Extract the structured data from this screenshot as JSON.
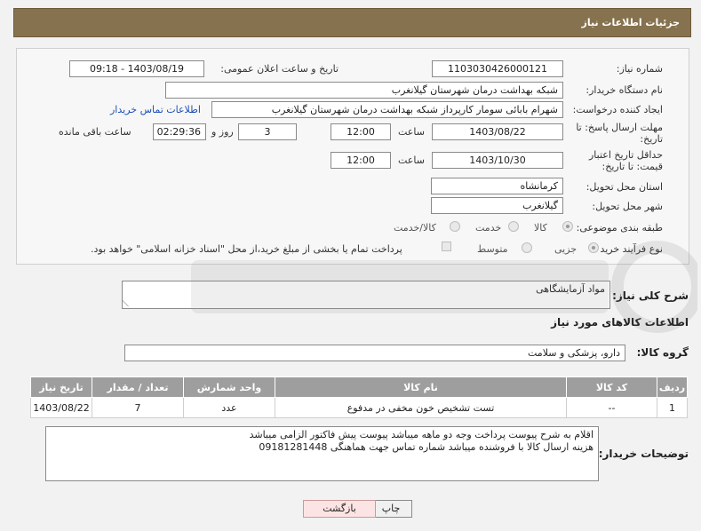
{
  "header": {
    "title": "جزئیات اطلاعات نیاز"
  },
  "form": {
    "need_number_label": "شماره نیاز:",
    "need_number": "1103030426000121",
    "announce_label": "تاریخ و ساعت اعلان عمومی:",
    "announce_value": "1403/08/19 - 09:18",
    "buyer_org_label": "نام دستگاه خریدار:",
    "buyer_org": "شبکه بهداشت درمان شهرستان گیلانغرب",
    "creator_label": "ایجاد کننده درخواست:",
    "creator": "شهرام بابائی سومار کارپرداز شبکه بهداشت درمان شهرستان گیلانغرب",
    "contact_link": "اطلاعات تماس خریدار",
    "reply_deadline_label": "مهلت ارسال پاسخ: تا تاریخ:",
    "reply_date": "1403/08/22",
    "time_label": "ساعت",
    "reply_time": "12:00",
    "days_value": "3",
    "days_label": "روز و",
    "remaining_time": "02:29:36",
    "remaining_label": "ساعت باقی مانده",
    "price_validity_label": "حداقل تاریخ اعتبار قیمت: تا تاریخ:",
    "price_date": "1403/10/30",
    "price_time": "12:00",
    "province_label": "استان محل تحویل:",
    "province": "کرمانشاه",
    "city_label": "شهر محل تحویل:",
    "city": "گیلانغرب",
    "category_label": "طبقه بندی موضوعی:",
    "category_options": [
      "کالا",
      "خدمت",
      "کالا/خدمت"
    ],
    "purchase_type_label": "نوع فرآیند خرید :",
    "purchase_options": [
      "جزیی",
      "متوسط"
    ],
    "treasury_note": "پرداخت تمام یا بخشی از مبلغ خرید،از محل \"اسناد خزانه اسلامی\" خواهد بود."
  },
  "description": {
    "label": "شرح کلی نیاز:",
    "value": "مواد آزمایشگاهی"
  },
  "goods_section": {
    "title": "اطلاعات کالاهای مورد نیاز",
    "group_label": "گروه کالا:",
    "group_value": "دارو، پزشکی و سلامت"
  },
  "table": {
    "headers": [
      "ردیف",
      "کد کالا",
      "نام کالا",
      "واحد شمارش",
      "تعداد / مقدار",
      "تاریخ نیاز"
    ],
    "rows": [
      [
        "1",
        "--",
        "تست تشخیص خون مخفی در مدفوع",
        "عدد",
        "7",
        "1403/08/22"
      ]
    ]
  },
  "buyer_notes": {
    "label": "توضیحات خریدار:",
    "line1": "اقلام به شرح پیوست پرداخت وجه دو ماهه میباشد پیوست پیش فاکتور الزامی میباشد",
    "line2": "هزینه ارسال کالا با فروشنده میباشد شماره تماس جهت هماهنگی 09181281448"
  },
  "buttons": {
    "print": "چاپ",
    "back": "بازگشت"
  },
  "colors": {
    "header_bg": "#86724e",
    "table_header_bg": "#9e9e9e",
    "link": "#1d4fb8"
  }
}
